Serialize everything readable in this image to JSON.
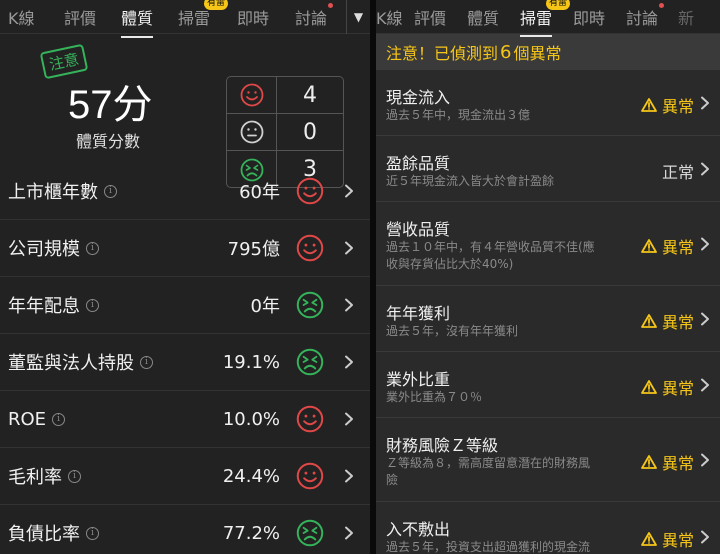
{
  "left": {
    "tabs": [
      {
        "label": "K線"
      },
      {
        "label": "評價"
      },
      {
        "label": "體質"
      },
      {
        "label": "掃雷"
      },
      {
        "label": "即時"
      },
      {
        "label": "討論"
      }
    ],
    "badge": "有雷",
    "stamp": "注意",
    "score": "57分",
    "score_label": "體質分數",
    "counts": {
      "red": "4",
      "neutral": "0",
      "green": "3"
    },
    "rows": [
      {
        "label": "上市櫃年數",
        "value": "60年",
        "face": "red"
      },
      {
        "label": "公司規模",
        "value": "795億",
        "face": "red"
      },
      {
        "label": "年年配息",
        "value": "0年",
        "face": "green"
      },
      {
        "label": "董監與法人持股",
        "value": "19.1%",
        "face": "green"
      },
      {
        "label": "ROE",
        "value": "10.0%",
        "face": "red"
      },
      {
        "label": "毛利率",
        "value": "24.4%",
        "face": "red"
      },
      {
        "label": "負債比率",
        "value": "77.2%",
        "face": "green"
      }
    ]
  },
  "right": {
    "tabs": [
      {
        "label": "K線"
      },
      {
        "label": "評價"
      },
      {
        "label": "體質"
      },
      {
        "label": "掃雷"
      },
      {
        "label": "即時"
      },
      {
        "label": "討論"
      },
      {
        "label": "新"
      }
    ],
    "badge": "有雷",
    "alert": {
      "prefix": "注意！已偵測到",
      "count": "6",
      "suffix": "個異常"
    },
    "items": [
      {
        "title": "現金流入",
        "desc": "過去５年中，現金流出３億",
        "status": "異常"
      },
      {
        "title": "盈餘品質",
        "desc": "近５年現金流入皆大於會計盈餘",
        "status": "正常"
      },
      {
        "title": "營收品質",
        "desc": "過去１０年中，有４年營收品質不佳(應收與存貨佔比大於40%)",
        "status": "異常"
      },
      {
        "title": "年年獲利",
        "desc": "過去５年，沒有年年獲利",
        "status": "異常"
      },
      {
        "title": "業外比重",
        "desc": "業外比重為７０％",
        "status": "異常"
      },
      {
        "title": "財務風險Ｚ等級",
        "desc": "Ｚ等級為８，需高度留意潛在的財務風險",
        "status": "異常"
      },
      {
        "title": "入不敷出",
        "desc": "過去５年，投資支出超過獲利的現金流",
        "status": "異常"
      }
    ]
  },
  "colors": {
    "red": "#e04848",
    "green": "#35b35a",
    "warning": "#f5c518"
  }
}
